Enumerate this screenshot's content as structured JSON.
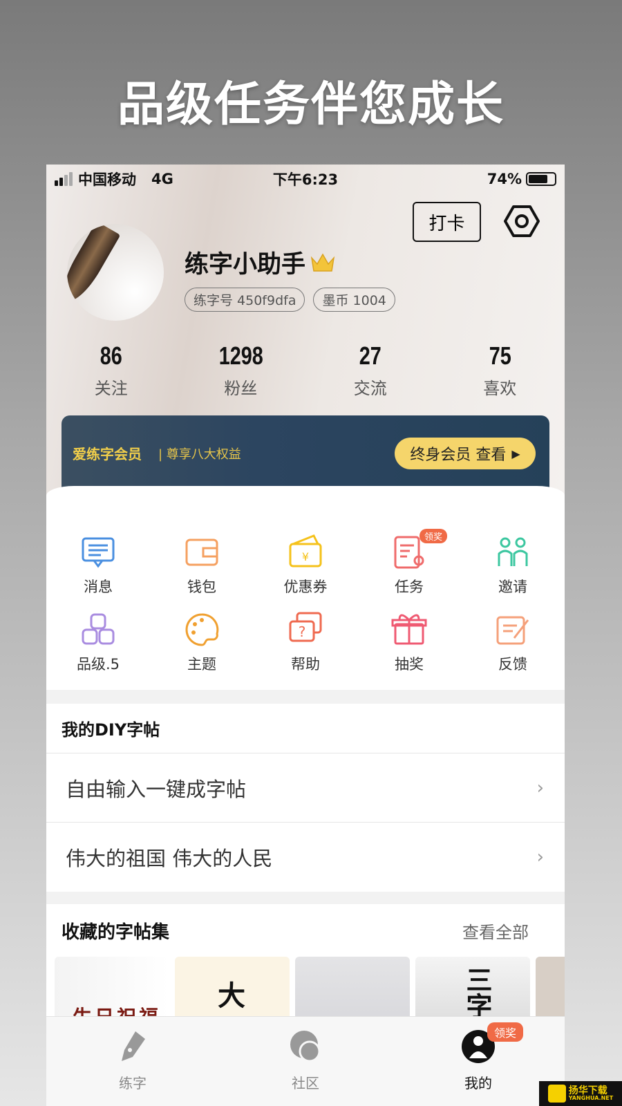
{
  "headline": "品级任务伴您成长",
  "status": {
    "carrier": "中国移动",
    "network": "4G",
    "time": "下午6:23",
    "battery": "74%",
    "battery_level": 0.74
  },
  "header": {
    "checkin_label": "打卡",
    "settings_icon": "hexagon-gear-icon"
  },
  "profile": {
    "name": "练字小助手",
    "crown_icon": "crown-icon",
    "id_tag": "练字号 450f9dfa",
    "coin_tag": "墨币 1004"
  },
  "stats": [
    {
      "value": "86",
      "label": "关注"
    },
    {
      "value": "1298",
      "label": "粉丝"
    },
    {
      "value": "27",
      "label": "交流"
    },
    {
      "value": "75",
      "label": "喜欢"
    }
  ],
  "vip": {
    "title": "爱练字会员",
    "subtitle": "| 尊享八大权益",
    "button": "终身会员 查看"
  },
  "grid": [
    {
      "label": "消息",
      "icon": "message-icon",
      "color": "#4a8fe0"
    },
    {
      "label": "钱包",
      "icon": "wallet-icon",
      "color": "#f5a060"
    },
    {
      "label": "优惠券",
      "icon": "coupon-icon",
      "color": "#f5c21b"
    },
    {
      "label": "任务",
      "icon": "task-icon",
      "color": "#ef6b6b",
      "badge": "领奖"
    },
    {
      "label": "邀请",
      "icon": "invite-icon",
      "color": "#3cc7a0"
    },
    {
      "label": "品级.5",
      "icon": "grade-icon",
      "color": "#a98ce0"
    },
    {
      "label": "主题",
      "icon": "palette-icon",
      "color": "#f0a030"
    },
    {
      "label": "帮助",
      "icon": "help-icon",
      "color": "#ef6a50"
    },
    {
      "label": "抽奖",
      "icon": "gift-icon",
      "color": "#ef5a72"
    },
    {
      "label": "反馈",
      "icon": "feedback-icon",
      "color": "#f5a07a"
    }
  ],
  "diy": {
    "title": "我的DIY字帖",
    "items": [
      "自由输入一键成字帖",
      "伟大的祖国 伟大的人民"
    ]
  },
  "favorites": {
    "title": "收藏的字帖集",
    "view_all": "查看全部",
    "thumbs": [
      "生日祝福",
      "大",
      "",
      "三字",
      ""
    ]
  },
  "tabs": [
    {
      "label": "练字",
      "icon": "pen-nib-icon"
    },
    {
      "label": "社区",
      "icon": "community-icon"
    },
    {
      "label": "我的",
      "icon": "user-icon",
      "badge": "领奖"
    }
  ],
  "watermark": {
    "name": "扬华下载",
    "site": "YANGHUA.NET"
  }
}
